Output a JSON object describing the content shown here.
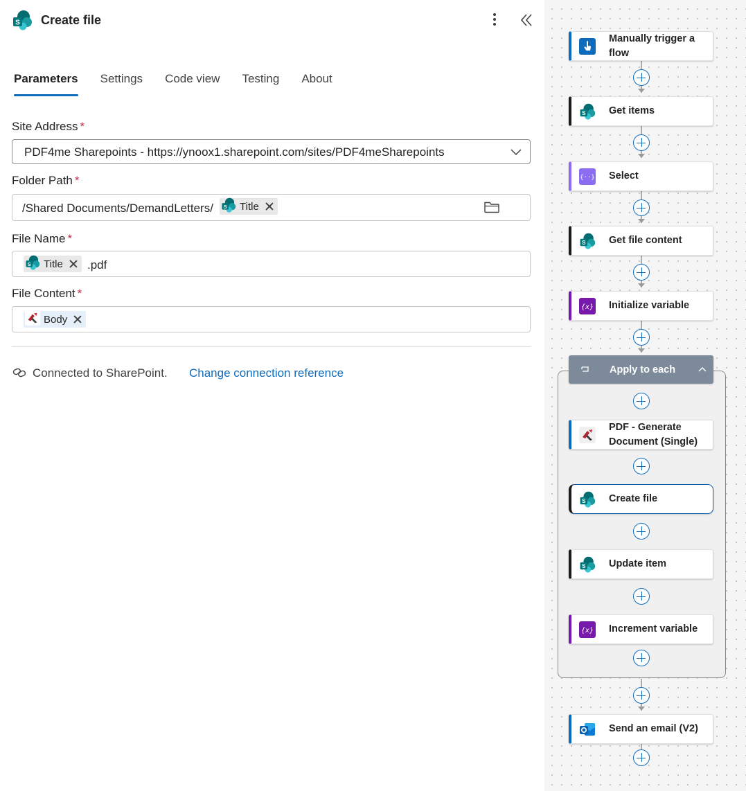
{
  "panel": {
    "title": "Create file",
    "tabs": [
      {
        "label": "Parameters",
        "active": true
      },
      {
        "label": "Settings"
      },
      {
        "label": "Code view"
      },
      {
        "label": "Testing"
      },
      {
        "label": "About"
      }
    ],
    "required_mark": "*",
    "site_address": {
      "label": "Site Address",
      "value": "PDF4me Sharepoints - https://ynoox1.sharepoint.com/sites/PDF4meSharepoints"
    },
    "folder_path": {
      "label": "Folder Path",
      "prefix": "/Shared Documents/DemandLetters/",
      "token": "Title"
    },
    "file_name": {
      "label": "File Name",
      "token": "Title",
      "suffix": ".pdf"
    },
    "file_content": {
      "label": "File Content",
      "token": "Body"
    },
    "connection": {
      "text": "Connected to SharePoint.",
      "link": "Change connection reference"
    }
  },
  "flow": {
    "steps": [
      {
        "label": "Manually trigger a flow",
        "icon": "trigger-icon",
        "accent": "#0f6cbd"
      },
      {
        "label": "Get items",
        "icon": "sharepoint-icon",
        "accent": "#1b1b1b"
      },
      {
        "label": "Select",
        "icon": "data-operation-icon",
        "accent": "#8c6cf0"
      },
      {
        "label": "Get file content",
        "icon": "sharepoint-icon",
        "accent": "#1b1b1b"
      },
      {
        "label": "Initialize variable",
        "icon": "variable-icon",
        "accent": "#7719aa"
      },
      {
        "label": "PDF - Generate Document (Single)",
        "icon": "pdf4me-icon",
        "accent": "#0f6cbd"
      },
      {
        "label": "Create file",
        "icon": "sharepoint-icon",
        "accent": "#1b1b1b",
        "selected": true
      },
      {
        "label": "Update item",
        "icon": "sharepoint-icon",
        "accent": "#1b1b1b"
      },
      {
        "label": "Increment variable",
        "icon": "variable-icon",
        "accent": "#7719aa"
      },
      {
        "label": "Send an email (V2)",
        "icon": "outlook-icon",
        "accent": "#0f6cbd"
      }
    ],
    "loop": {
      "label": "Apply to each"
    }
  },
  "colors": {
    "accent": "#0f6cbd",
    "required": "#c4314b",
    "sharepoint": "#038387",
    "variable": "#7719aa",
    "scope_header": "#7c8a99"
  }
}
